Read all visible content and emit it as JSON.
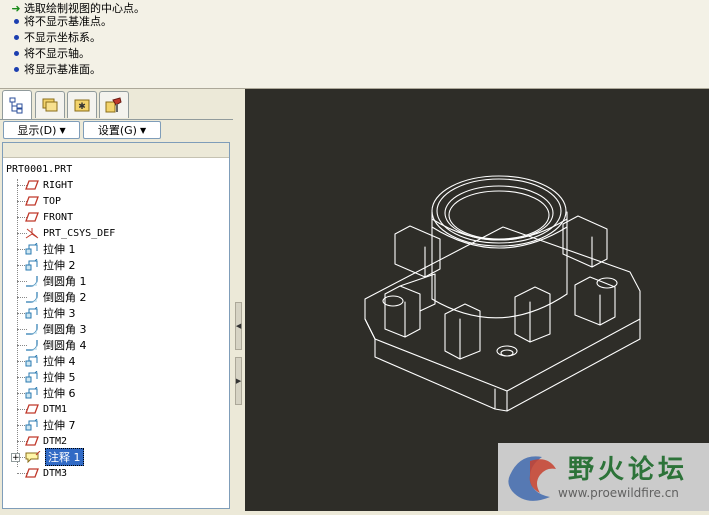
{
  "messages": [
    {
      "type": "arrow",
      "text": "选取绘制视图的中心点。"
    },
    {
      "type": "dot",
      "text": "将不显示基准点。"
    },
    {
      "type": "dot",
      "text": "不显示坐标系。"
    },
    {
      "type": "dot",
      "text": "将不显示轴。"
    },
    {
      "type": "dot",
      "text": "将显示基准面。"
    }
  ],
  "toolbar": {
    "show_label": "显示(D)",
    "settings_label": "设置(G)"
  },
  "tree": {
    "root": "PRT0001.PRT",
    "items": [
      {
        "icon": "datum-plane-icon",
        "label": "RIGHT"
      },
      {
        "icon": "datum-plane-icon",
        "label": "TOP"
      },
      {
        "icon": "datum-plane-icon",
        "label": "FRONT"
      },
      {
        "icon": "coordinate-system-icon",
        "label": "PRT_CSYS_DEF"
      },
      {
        "icon": "extrude-icon",
        "label": "拉伸 1"
      },
      {
        "icon": "extrude-icon",
        "label": "拉伸 2"
      },
      {
        "icon": "round-icon",
        "label": "倒圆角 1"
      },
      {
        "icon": "round-icon",
        "label": "倒圆角 2"
      },
      {
        "icon": "extrude-icon",
        "label": "拉伸 3"
      },
      {
        "icon": "round-icon",
        "label": "倒圆角 3"
      },
      {
        "icon": "round-icon",
        "label": "倒圆角 4"
      },
      {
        "icon": "extrude-icon",
        "label": "拉伸 4"
      },
      {
        "icon": "extrude-icon",
        "label": "拉伸 5"
      },
      {
        "icon": "extrude-icon",
        "label": "拉伸 6"
      },
      {
        "icon": "datum-plane-icon",
        "label": "DTM1"
      },
      {
        "icon": "extrude-icon",
        "label": "拉伸 7"
      },
      {
        "icon": "datum-plane-icon",
        "label": "DTM2"
      },
      {
        "icon": "annotation-icon",
        "label": "注释 1",
        "selected": true
      },
      {
        "icon": "datum-plane-icon",
        "label": "DTM3"
      }
    ]
  },
  "watermark": {
    "title": "野火论坛",
    "url": "www.proewildfire.cn"
  },
  "colors": {
    "viewport_bg": "#2e2d28",
    "model_line": "#ffffff",
    "selection": "#316ac5"
  }
}
